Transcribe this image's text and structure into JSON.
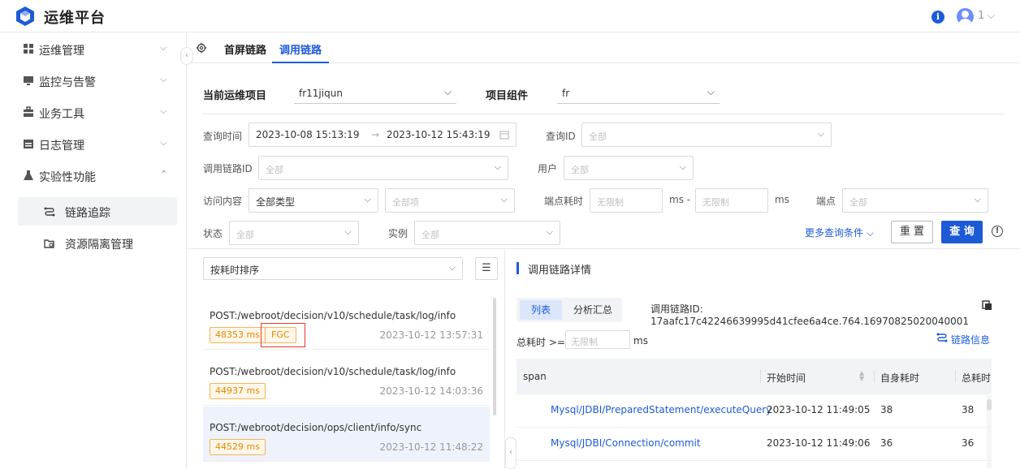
{
  "app": {
    "title": "运维平台",
    "user_count": "1"
  },
  "sidebar": {
    "items": [
      {
        "label": "运维管理",
        "icon": "grid-icon"
      },
      {
        "label": "监控与告警",
        "icon": "monitor-icon"
      },
      {
        "label": "业务工具",
        "icon": "toolbox-icon"
      },
      {
        "label": "日志管理",
        "icon": "calendar-icon"
      },
      {
        "label": "实验性功能",
        "icon": "flask-icon"
      }
    ],
    "subitems": [
      {
        "label": "链路追踪",
        "active": true
      },
      {
        "label": "资源隔离管理",
        "active": false
      }
    ]
  },
  "tabs": [
    {
      "label": "首屏链路",
      "active": false
    },
    {
      "label": "调用链路",
      "active": true
    }
  ],
  "filters": {
    "project_label": "当前运维项目",
    "project_value": "fr11jiqun",
    "component_label": "项目组件",
    "component_value": "fr",
    "query_time_label": "查询时间",
    "time_start": "2023-10-08 15:13:19",
    "time_end": "2023-10-12 15:43:19",
    "time_sep": "→",
    "query_id_label": "查询ID",
    "trace_id_label": "调用链路ID",
    "user_label": "用户",
    "access_label": "访问内容",
    "access_type_value": "全部类型",
    "endpoint_cost_label": "端点耗时",
    "endpoint_label": "端点",
    "status_label": "状态",
    "instance_label": "实例",
    "all_placeholder": "全部",
    "all_items_placeholder": "全部项",
    "unlimited_placeholder": "无限制",
    "ms_dash": "ms -",
    "ms": "ms",
    "more_label": "更多查询条件",
    "reset_label": "重 置",
    "query_label": "查 询"
  },
  "list": {
    "sort_value": "按耗时排序",
    "requests": [
      {
        "path": "POST:/webroot/decision/v10/schedule/task/log/info",
        "ms": "48353 ms",
        "tag": "FGC",
        "time": "2023-10-12 13:57:31"
      },
      {
        "path": "POST:/webroot/decision/v10/schedule/task/log/info",
        "ms": "44937 ms",
        "tag": "",
        "time": "2023-10-12 14:03:36"
      },
      {
        "path": "POST:/webroot/decision/ops/client/info/sync",
        "ms": "44529 ms",
        "tag": "",
        "time": "2023-10-12 11:48:22"
      }
    ]
  },
  "detail": {
    "title": "调用链路详情",
    "seg_list": "列表",
    "seg_summary": "分析汇总",
    "trace_id": "调用链路ID: 17aafc17c42246639995d41cfee6a4ce.764.16970825020040001",
    "total_cost_label": "总耗时 >=",
    "total_cost_placeholder": "无限制",
    "total_cost_unit": "ms",
    "link_info": "链路信息",
    "table": {
      "columns": [
        "span",
        "开始时间",
        "自身耗时",
        "总耗时"
      ],
      "rows": [
        {
          "span": "Mysql/JDBI/PreparedStatement/executeQuery",
          "start": "2023-10-12 11:49:05",
          "self": "38",
          "total": "38"
        },
        {
          "span": "Mysql/JDBI/Connection/commit",
          "start": "2023-10-12 11:49:06",
          "self": "36",
          "total": "36"
        }
      ]
    }
  },
  "colors": {
    "accent": "#1d5bd6",
    "warn_tag": "#e08a00",
    "highlight": "#e53935"
  }
}
